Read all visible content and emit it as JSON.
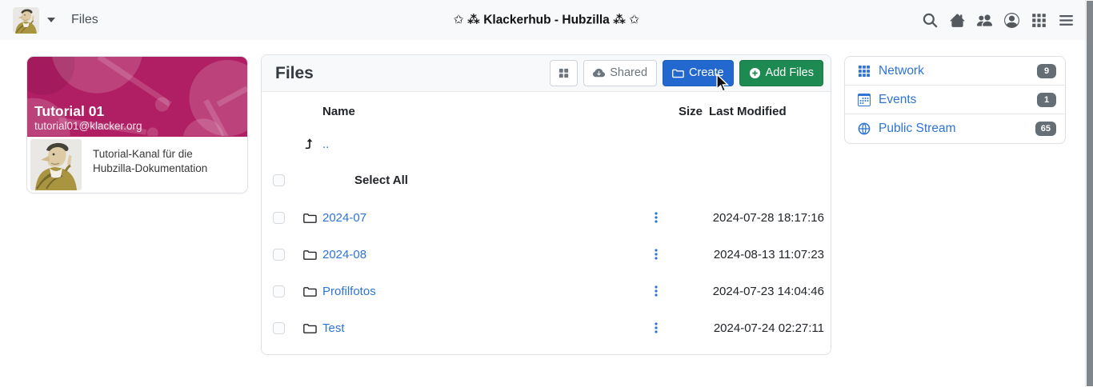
{
  "navbar": {
    "app_label": "Files",
    "site_title": "✩ ⁂ Klackerhub - Hubzilla ⁂ ✩",
    "icons": [
      "search-icon",
      "home-icon",
      "connections-icon",
      "account-icon",
      "apps-grid-icon",
      "menu-icon"
    ]
  },
  "profile_card": {
    "name": "Tutorial 01",
    "address": "tutorial01@klacker.org",
    "description": "Tutorial-Kanal für die Hubzilla-Dokumentation"
  },
  "files_panel": {
    "title": "Files",
    "buttons": {
      "view_icon": "grid-2x2-icon",
      "shared_label": "Shared",
      "create_label": "Create",
      "add_files_label": "Add Files"
    },
    "table": {
      "headers": {
        "name": "Name",
        "size": "Size",
        "last_modified": "Last Modified"
      },
      "parent_link_label": "..",
      "select_all_label": "Select All",
      "rows": [
        {
          "name": "2024-07",
          "size": "",
          "modified": "2024-07-28 18:17:16"
        },
        {
          "name": "2024-08",
          "size": "",
          "modified": "2024-08-13 11:07:23"
        },
        {
          "name": "Profilfotos",
          "size": "",
          "modified": "2024-07-23 14:04:46"
        },
        {
          "name": "Test",
          "size": "",
          "modified": "2024-07-24 02:27:11"
        }
      ]
    }
  },
  "right_sidebar": {
    "items": [
      {
        "label": "Network",
        "count": "9",
        "icon": "grid-3x3-icon"
      },
      {
        "label": "Events",
        "count": "1",
        "icon": "calendar-icon"
      },
      {
        "label": "Public Stream",
        "count": "65",
        "icon": "globe-icon"
      }
    ]
  },
  "colors": {
    "link_blue": "#2e74d6",
    "create_blue": "#2268cf",
    "add_green": "#1d8a52",
    "badge_gray": "#656d75",
    "banner_magenta": "#b01e63",
    "icon_gray": "#54595f"
  }
}
